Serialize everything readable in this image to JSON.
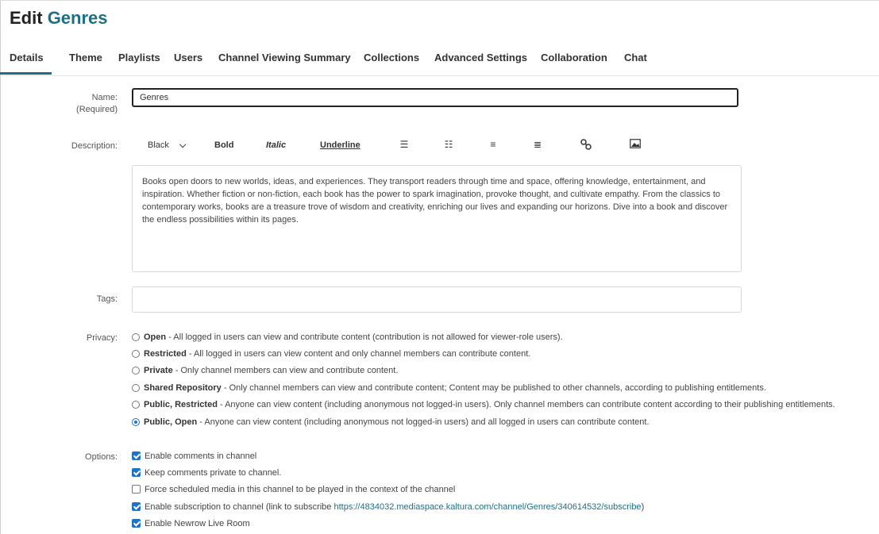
{
  "header": {
    "title_prefix": "Edit",
    "title_name": "Genres"
  },
  "tabs": [
    {
      "label": "Details",
      "active": true
    },
    {
      "label": "Theme"
    },
    {
      "label": "Playlists"
    },
    {
      "label": "Users"
    },
    {
      "label": "Channel Viewing Summary"
    },
    {
      "label": "Collections"
    },
    {
      "label": "Advanced Settings"
    },
    {
      "label": "Collaboration"
    },
    {
      "label": "Chat"
    }
  ],
  "form": {
    "name_label": "Name:",
    "name_required": "(Required)",
    "name_value": "Genres",
    "description_label": "Description:",
    "toolbar": {
      "color": "Black",
      "bold": "Bold",
      "italic": "Italic",
      "underline": "Underline",
      "icons": [
        "ordered-list-icon",
        "unordered-list-icon",
        "outdent-icon",
        "indent-icon",
        "link-icon",
        "image-icon"
      ]
    },
    "description_text": "Books open doors to new worlds, ideas, and experiences. They transport readers through time and space, offering knowledge, entertainment, and inspiration. Whether fiction or non-fiction, each book has the power to spark imagination, provoke thought, and cultivate empathy. From the classics to contemporary works, books are a treasure trove of wisdom and creativity, enriching our lives and expanding our horizons. Dive into a book and discover the endless possibilities within its pages.",
    "tags_label": "Tags:",
    "tags_value": "",
    "privacy_label": "Privacy:",
    "privacy_options": [
      {
        "title": "Open",
        "desc": " - All logged in users can view and contribute content (contribution is not allowed for viewer-role users).",
        "checked": false
      },
      {
        "title": "Restricted",
        "desc": " - All logged in users can view content and only channel members can contribute content.",
        "checked": false
      },
      {
        "title": "Private",
        "desc": " - Only channel members can view and contribute content.",
        "checked": false
      },
      {
        "title": "Shared Repository",
        "desc": " - Only channel members can view and contribute content; Content may be published to other channels, according to publishing entitlements.",
        "checked": false
      },
      {
        "title": "Public, Restricted",
        "desc": " - Anyone can view content (including anonymous not logged-in users). Only channel members can contribute content according to their publishing entitlements.",
        "checked": false
      },
      {
        "title": "Public, Open",
        "desc": " - Anyone can view content (including anonymous not logged-in users) and all logged in users can contribute content.",
        "checked": true
      }
    ],
    "options_label": "Options:",
    "options": [
      {
        "label": "Enable comments in channel",
        "checked": true
      },
      {
        "label": "Keep comments private to channel.",
        "checked": true
      },
      {
        "label": "Force scheduled media in this channel to be played in the context of the channel",
        "checked": false
      },
      {
        "label": "Enable subscription to channel (link to subscribe ",
        "link": "https://4834032.mediaspace.kaltura.com/channel/Genres/340614532/subscribe",
        "suffix": ")",
        "checked": true
      },
      {
        "label": "Enable Newrow Live Room",
        "checked": true
      }
    ]
  }
}
